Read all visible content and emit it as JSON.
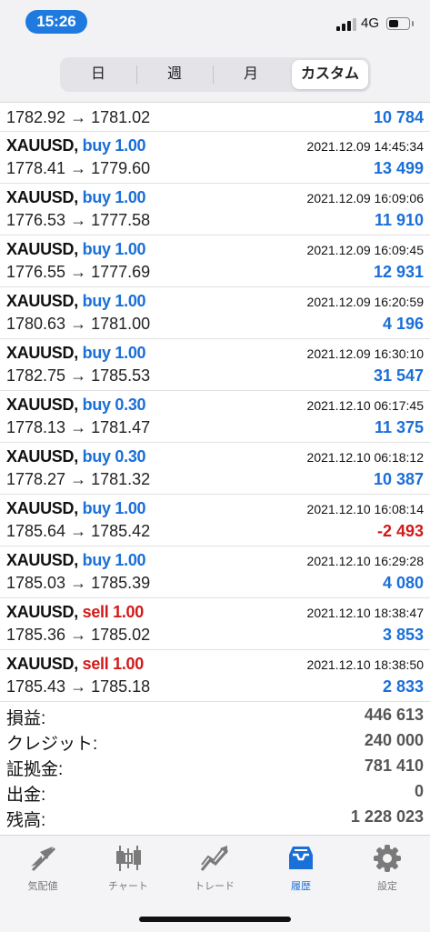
{
  "status_bar": {
    "time": "15:26",
    "network": "4G"
  },
  "period_tabs": [
    "日",
    "週",
    "月",
    "カスタム"
  ],
  "active_period": "カスタム",
  "first_row": {
    "prices": "1782.92 → 1781.02",
    "profit": "10 784",
    "profit_sign": "pos"
  },
  "deals": [
    {
      "symbol": "XAUUSD,",
      "action": "buy 1.00",
      "side": "buy",
      "datetime": "2021.12.09 14:45:34",
      "prices": "1778.41 → 1779.60",
      "profit": "13 499",
      "profit_sign": "pos"
    },
    {
      "symbol": "XAUUSD,",
      "action": "buy 1.00",
      "side": "buy",
      "datetime": "2021.12.09 16:09:06",
      "prices": "1776.53 → 1777.58",
      "profit": "11 910",
      "profit_sign": "pos"
    },
    {
      "symbol": "XAUUSD,",
      "action": "buy 1.00",
      "side": "buy",
      "datetime": "2021.12.09 16:09:45",
      "prices": "1776.55 → 1777.69",
      "profit": "12 931",
      "profit_sign": "pos"
    },
    {
      "symbol": "XAUUSD,",
      "action": "buy 1.00",
      "side": "buy",
      "datetime": "2021.12.09 16:20:59",
      "prices": "1780.63 → 1781.00",
      "profit": "4 196",
      "profit_sign": "pos"
    },
    {
      "symbol": "XAUUSD,",
      "action": "buy 1.00",
      "side": "buy",
      "datetime": "2021.12.09 16:30:10",
      "prices": "1782.75 → 1785.53",
      "profit": "31 547",
      "profit_sign": "pos"
    },
    {
      "symbol": "XAUUSD,",
      "action": "buy 0.30",
      "side": "buy",
      "datetime": "2021.12.10 06:17:45",
      "prices": "1778.13 → 1781.47",
      "profit": "11 375",
      "profit_sign": "pos"
    },
    {
      "symbol": "XAUUSD,",
      "action": "buy 0.30",
      "side": "buy",
      "datetime": "2021.12.10 06:18:12",
      "prices": "1778.27 → 1781.32",
      "profit": "10 387",
      "profit_sign": "pos"
    },
    {
      "symbol": "XAUUSD,",
      "action": "buy 1.00",
      "side": "buy",
      "datetime": "2021.12.10 16:08:14",
      "prices": "1785.64 → 1785.42",
      "profit": "-2 493",
      "profit_sign": "neg"
    },
    {
      "symbol": "XAUUSD,",
      "action": "buy 1.00",
      "side": "buy",
      "datetime": "2021.12.10 16:29:28",
      "prices": "1785.03 → 1785.39",
      "profit": "4 080",
      "profit_sign": "pos"
    },
    {
      "symbol": "XAUUSD,",
      "action": "sell 1.00",
      "side": "sell",
      "datetime": "2021.12.10 18:38:47",
      "prices": "1785.36 → 1785.02",
      "profit": "3 853",
      "profit_sign": "pos"
    },
    {
      "symbol": "XAUUSD,",
      "action": "sell 1.00",
      "side": "sell",
      "datetime": "2021.12.10 18:38:50",
      "prices": "1785.43 → 1785.18",
      "profit": "2 833",
      "profit_sign": "pos"
    }
  ],
  "summary": [
    {
      "label": "損益:",
      "value": "446 613"
    },
    {
      "label": "クレジット:",
      "value": "240 000"
    },
    {
      "label": "証拠金:",
      "value": "781 410"
    },
    {
      "label": "出金:",
      "value": "0"
    },
    {
      "label": "残高:",
      "value": "1 228 023"
    }
  ],
  "tabbar": [
    {
      "label": "気配値",
      "icon": "quotes-icon"
    },
    {
      "label": "チャート",
      "icon": "chart-icon"
    },
    {
      "label": "トレード",
      "icon": "trade-icon"
    },
    {
      "label": "履歴",
      "icon": "history-icon"
    },
    {
      "label": "設定",
      "icon": "settings-icon"
    }
  ],
  "active_tab": "履歴",
  "colors": {
    "accent": "#1a6fd8",
    "loss": "#d21a1a",
    "time_pill": "#1f7ae0"
  }
}
